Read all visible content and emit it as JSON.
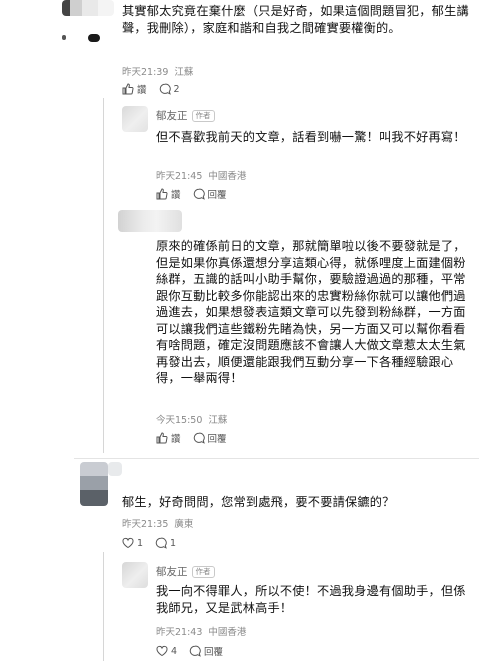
{
  "comment1": {
    "text": "其實郁太究竟在棄什麼（只是好奇，如果這個問題冒犯，郁生講聲，我刪除），家庭和諧和自我之間確實要權衡的。",
    "time": "昨天21:39",
    "location": "江蘇",
    "actions": [
      {
        "icon": "thumbs-up-icon",
        "label": "讚"
      },
      {
        "icon": "comment-icon",
        "label": "2"
      }
    ]
  },
  "reply1": {
    "name": "郁友正",
    "badge": "作者",
    "text": "但不喜歡我前天的文章，話看到嚇一驚！叫我不好再寫！",
    "time": "昨天21:45",
    "location": "中國香港",
    "actions": [
      {
        "icon": "thumbs-up-icon",
        "label": "讚"
      },
      {
        "icon": "comment-icon",
        "label": "回覆"
      }
    ]
  },
  "reply2": {
    "text": "原來的確係前日的文章，那就簡單啦以後不要發就是了，但是如果你真係還想分享這類心得，就係哩度上面建個粉絲群，五識的話叫小助手幫你，要驗證過過的那種，平常跟你互動比較多你能認出來的忠實粉絲你就可以讓他們過過進去，如果想發表這類文章可以先發到粉絲群，一方面可以讓我們這些鐵粉先睹為快，另一方面又可以幫你看看有啥問題，確定沒問題應該不會讓人大做文章惹太太生氣再發出去，順便還能跟我們互動分享一下各種經驗跟心得，一舉兩得！",
    "time": "今天15:50",
    "location": "江蘇",
    "actions": [
      {
        "icon": "thumbs-up-icon",
        "label": "讚"
      },
      {
        "icon": "comment-icon",
        "label": "回覆"
      }
    ]
  },
  "comment2": {
    "text": "郁生，好奇問問，您常到處飛，要不要請保鑣的？",
    "time": "昨天21:35",
    "location": "廣東",
    "actions": [
      {
        "icon": "heart-icon",
        "label": "1"
      },
      {
        "icon": "comment-icon",
        "label": "1"
      }
    ]
  },
  "reply3": {
    "name": "郁友正",
    "badge": "作者",
    "text": "我一向不得罪人，所以不使！不過我身邊有個助手，但係我師兄，又是武林高手！",
    "time": "昨天21:43",
    "location": "中國香港",
    "actions": [
      {
        "icon": "heart-icon",
        "label": "4"
      },
      {
        "icon": "comment-icon",
        "label": "回覆"
      }
    ]
  }
}
